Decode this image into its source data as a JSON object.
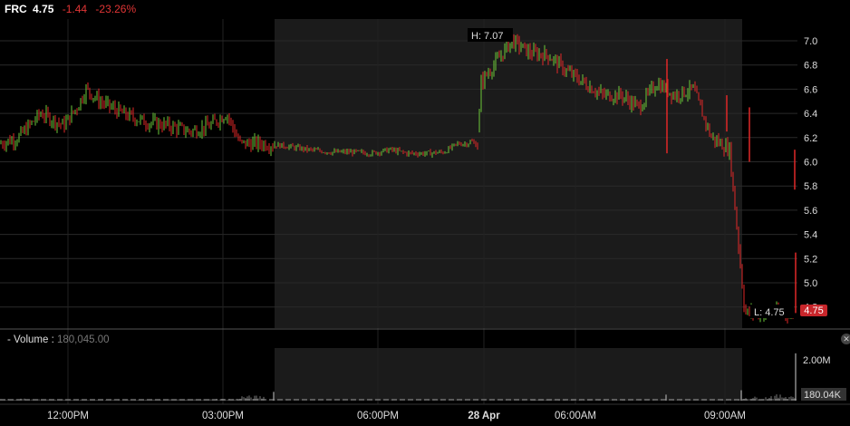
{
  "header": {
    "symbol": "FRC",
    "price": "4.75",
    "change": "-1.44",
    "change_pct": "-23.26%"
  },
  "volume_panel": {
    "label": "- Volume :",
    "value": "180,045.00"
  },
  "colors": {
    "up": "#6cc83a",
    "down": "#e02828",
    "extended_bg": "#1b1b1b",
    "price_tag": "#c8262b"
  },
  "chart_data": [
    {
      "type": "candlestick",
      "title": "FRC",
      "xlabel": "",
      "ylabel": "",
      "x_ticks": [
        "12:00PM",
        "03:00PM",
        "06:00PM",
        "28 Apr",
        "06:00AM",
        "09:00AM"
      ],
      "y_ticks": [
        "4.8",
        "5.0",
        "5.2",
        "5.4",
        "5.6",
        "5.8",
        "6.0",
        "6.2",
        "6.4",
        "6.6",
        "6.8",
        "7.0"
      ],
      "ylim": [
        4.75,
        7.15
      ],
      "grid": true,
      "extended_hours_shaded": true,
      "annotations": [
        {
          "label": "H: 7.07",
          "value": 7.07
        },
        {
          "label": "L: 4.75",
          "value": 4.75
        }
      ],
      "last_price_tag": "4.75",
      "series": [
        {
          "x": [
            "09:30",
            "10:00",
            "10:30",
            "11:00",
            "11:30",
            "12:00",
            "12:30",
            "13:00",
            "13:30",
            "14:00",
            "14:30",
            "15:00",
            "15:30",
            "16:00",
            "16:30",
            "17:00",
            "17:30",
            "18:00",
            "18:30",
            "19:00",
            "19:30",
            "20:00",
            "20:30",
            "21:00",
            "21:30",
            "22:00",
            "22:30",
            "23:00",
            "23:30",
            "28 Apr 00:00",
            "04:00",
            "04:30",
            "05:00",
            "05:30",
            "06:00",
            "06:30",
            "07:00",
            "07:30",
            "08:00",
            "08:30",
            "09:00",
            "09:30",
            "10:00",
            "10:30",
            "11:00",
            "11:30"
          ],
          "values": [
            6.15,
            6.2,
            6.4,
            6.3,
            6.45,
            6.6,
            6.5,
            6.4,
            6.33,
            6.3,
            6.25,
            6.3,
            6.4,
            6.15,
            6.15,
            6.13,
            6.1,
            6.08,
            6.08,
            6.07,
            6.1,
            6.07,
            6.07,
            6.08,
            6.15,
            6.15,
            6.17,
            6.15,
            6.13,
            6.13,
            6.65,
            6.8,
            7.0,
            6.9,
            6.88,
            6.75,
            6.65,
            6.55,
            6.55,
            6.45,
            6.65,
            6.55,
            6.6,
            6.2,
            6.1,
            4.75
          ]
        }
      ]
    },
    {
      "type": "bar",
      "title": "Volume",
      "y_ticks": [
        "2.00M"
      ],
      "ylim": [
        0,
        2200000
      ],
      "last_value_tag": "180.04K",
      "values_note": "",
      "series": [
        {
          "values": [
            60000,
            45000,
            40000,
            35000,
            30000,
            30000,
            40000,
            45000,
            60000,
            150000,
            8000,
            6000,
            5000,
            6000,
            7000,
            6000,
            8000,
            10000,
            12000,
            15000,
            90000,
            60000,
            50000,
            40000,
            35000,
            30000,
            30000,
            45000,
            120000,
            180045
          ]
        }
      ]
    }
  ]
}
